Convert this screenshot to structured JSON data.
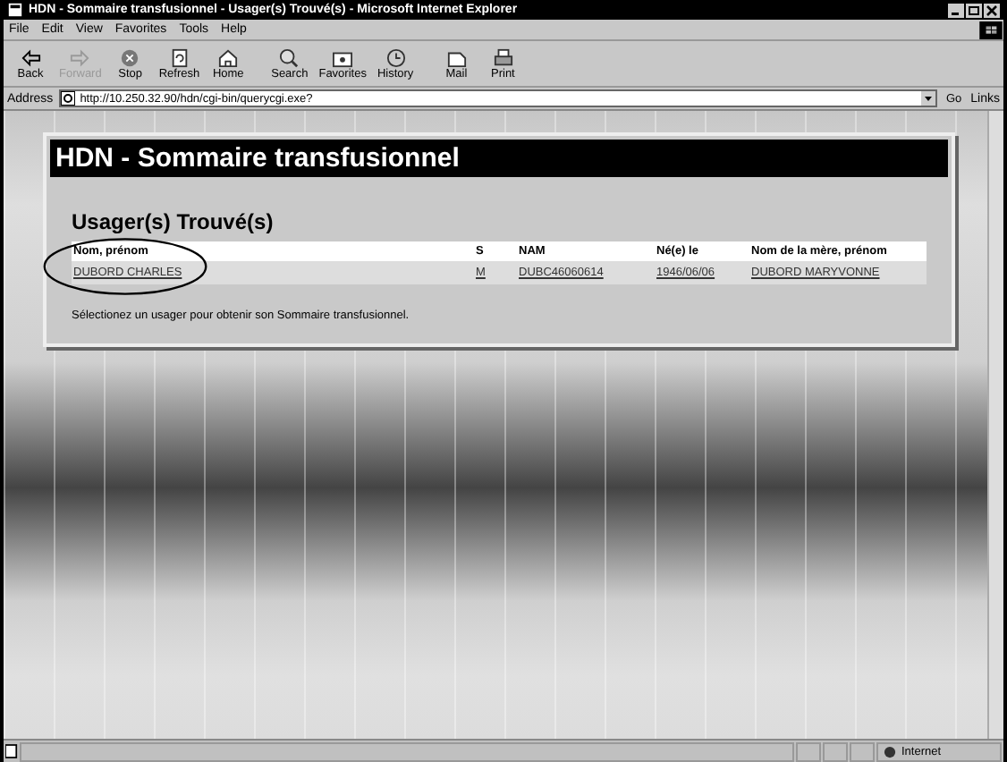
{
  "window": {
    "title": "HDN - Sommaire transfusionnel - Usager(s) Trouvé(s) - Microsoft Internet Explorer"
  },
  "menu": [
    "File",
    "Edit",
    "View",
    "Favorites",
    "Tools",
    "Help"
  ],
  "toolbar": [
    {
      "kind": "back",
      "label": "Back",
      "disabled": false
    },
    {
      "kind": "forward",
      "label": "Forward",
      "disabled": true
    },
    {
      "kind": "stop",
      "label": "Stop",
      "disabled": false
    },
    {
      "kind": "refresh",
      "label": "Refresh",
      "disabled": false
    },
    {
      "kind": "home",
      "label": "Home",
      "disabled": false
    },
    {
      "kind": "search",
      "label": "Search",
      "disabled": false
    },
    {
      "kind": "favorites",
      "label": "Favorites",
      "disabled": false
    },
    {
      "kind": "history",
      "label": "History",
      "disabled": false
    },
    {
      "kind": "mail",
      "label": "Mail",
      "disabled": false
    },
    {
      "kind": "print",
      "label": "Print",
      "disabled": false
    }
  ],
  "address": {
    "label": "Address",
    "value": "http://10.250.32.90/hdn/cgi-bin/querycgi.exe?",
    "go": "Go",
    "links": "Links"
  },
  "page": {
    "banner": "HDN - Sommaire transfusionnel",
    "heading": "Usager(s) Trouvé(s)",
    "table": {
      "columns": [
        "Nom, prénom",
        "S",
        "NAM",
        "Né(e) le",
        "Nom de la mère, prénom"
      ],
      "rows": [
        [
          "DUBORD CHARLES",
          "M",
          "DUBC46060614",
          "1946/06/06",
          "DUBORD MARYVONNE"
        ]
      ]
    },
    "instruction": "Sélectionez un usager pour obtenir son Sommaire transfusionnel."
  },
  "status_bar": {
    "zone": "Internet"
  }
}
